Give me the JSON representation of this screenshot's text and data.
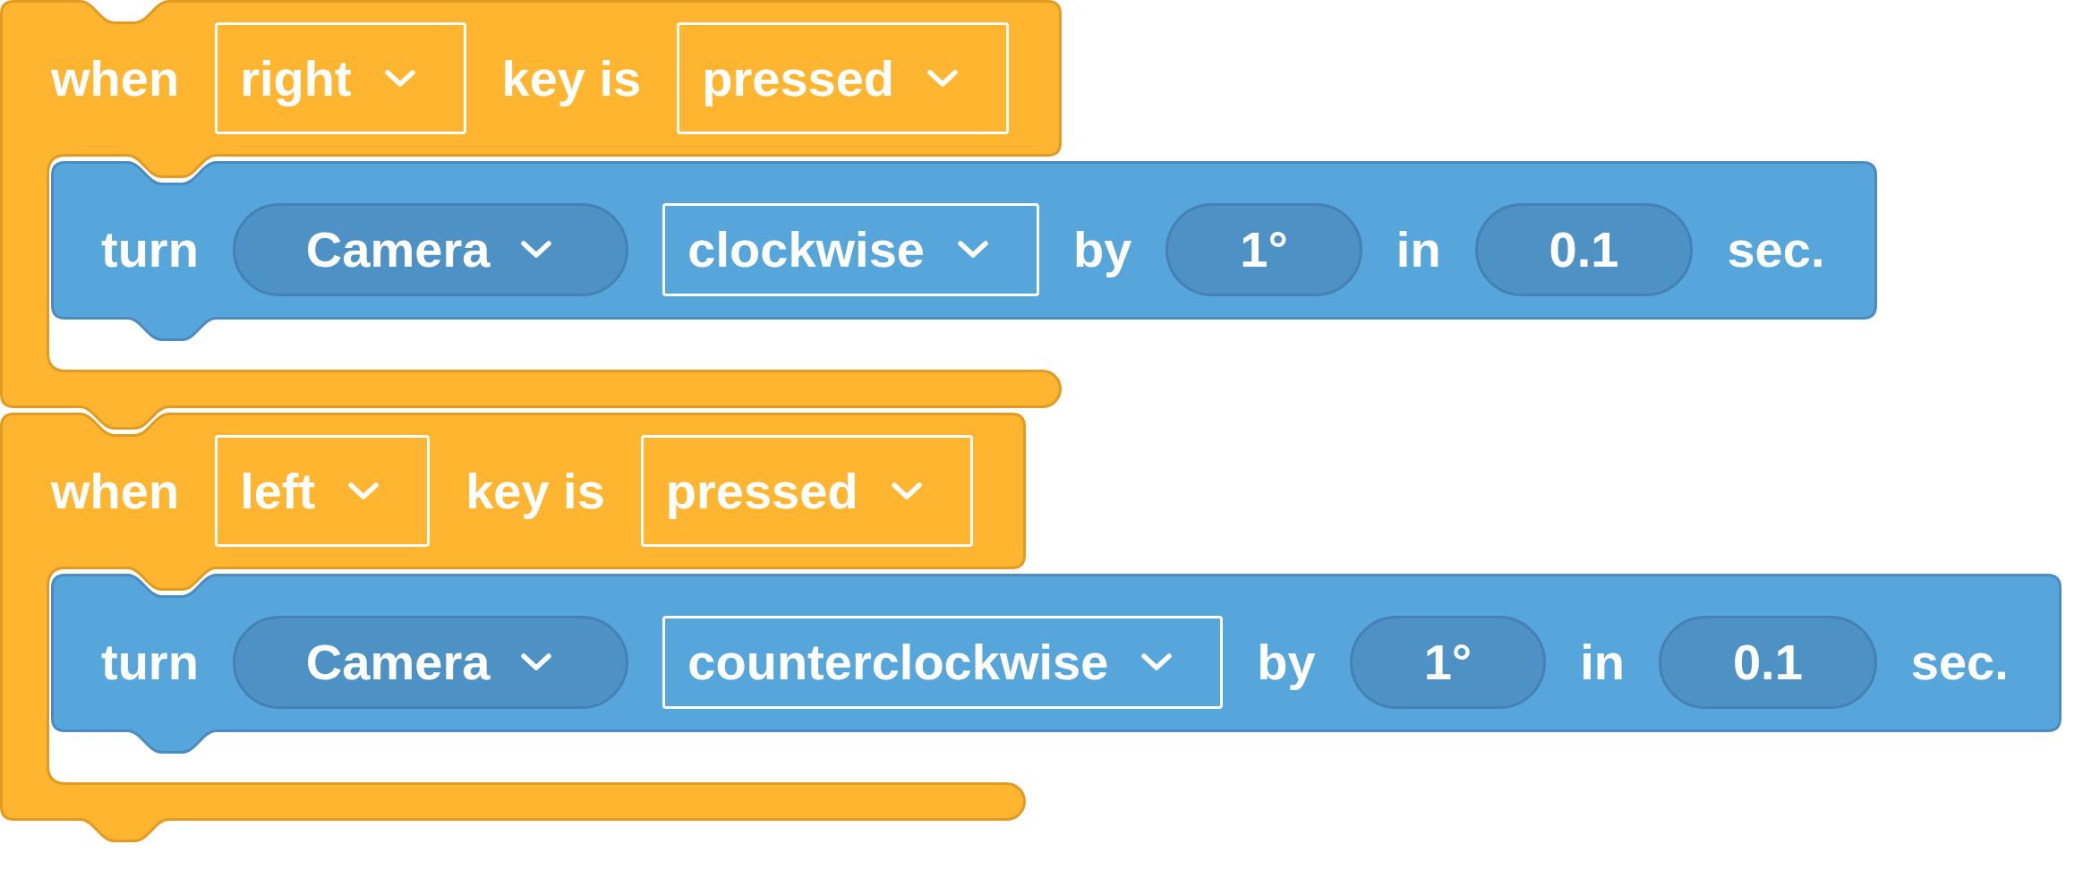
{
  "scripts": [
    {
      "event": {
        "parts": [
          {
            "kind": "label",
            "text": "when"
          },
          {
            "kind": "dropdown",
            "text": "right"
          },
          {
            "kind": "label",
            "text": "key is"
          },
          {
            "kind": "dropdown",
            "text": "pressed"
          }
        ]
      },
      "body": [
        {
          "parts": [
            {
              "kind": "label",
              "text": "turn"
            },
            {
              "kind": "pill",
              "text": "Camera"
            },
            {
              "kind": "dropdown",
              "text": "clockwise"
            },
            {
              "kind": "label",
              "text": "by"
            },
            {
              "kind": "number",
              "text": "1°"
            },
            {
              "kind": "label",
              "text": "in"
            },
            {
              "kind": "number",
              "text": "0.1"
            },
            {
              "kind": "label",
              "text": "sec."
            }
          ]
        }
      ]
    },
    {
      "event": {
        "parts": [
          {
            "kind": "label",
            "text": "when"
          },
          {
            "kind": "dropdown",
            "text": "left"
          },
          {
            "kind": "label",
            "text": "key is"
          },
          {
            "kind": "dropdown",
            "text": "pressed"
          }
        ]
      },
      "body": [
        {
          "parts": [
            {
              "kind": "label",
              "text": "turn"
            },
            {
              "kind": "pill",
              "text": "Camera"
            },
            {
              "kind": "dropdown",
              "text": "counterclockwise"
            },
            {
              "kind": "label",
              "text": "by"
            },
            {
              "kind": "number",
              "text": "1°"
            },
            {
              "kind": "label",
              "text": "in"
            },
            {
              "kind": "number",
              "text": "0.1"
            },
            {
              "kind": "label",
              "text": "sec."
            }
          ]
        }
      ]
    }
  ]
}
